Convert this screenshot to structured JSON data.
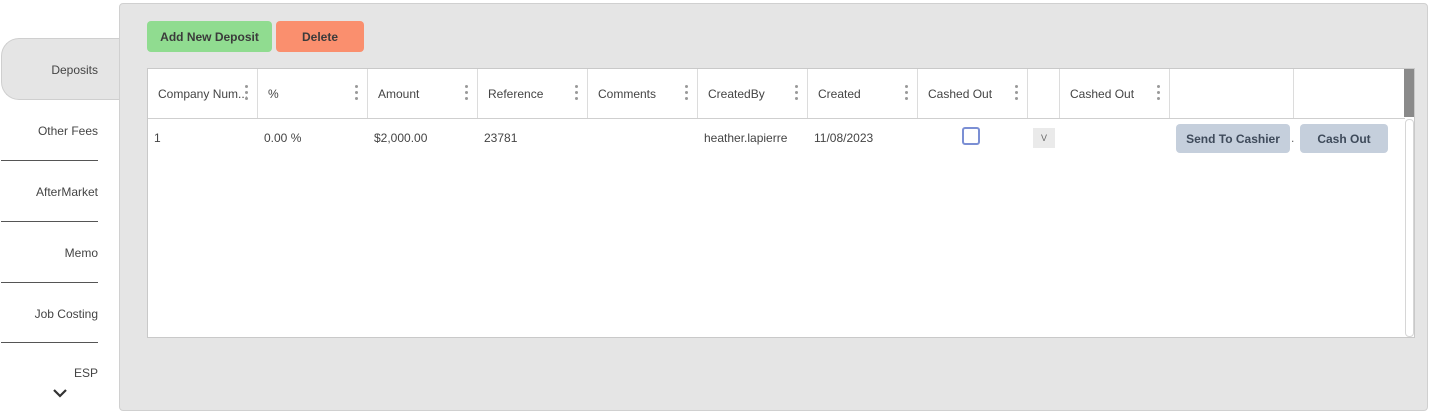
{
  "sidebar": {
    "tabs": [
      {
        "label": "Deposits",
        "active": true
      },
      {
        "label": "Other Fees"
      },
      {
        "label": "AfterMarket"
      },
      {
        "label": "Memo"
      },
      {
        "label": "Job Costing"
      },
      {
        "label": "ESP"
      }
    ],
    "more_icon": "chevron-down-icon"
  },
  "toolbar": {
    "add_label": "Add New Deposit",
    "delete_label": "Delete"
  },
  "grid": {
    "columns": [
      "Company Num...",
      "%",
      "Amount",
      "Reference",
      "Comments",
      "CreatedBy",
      "Created",
      "Cashed Out",
      "",
      "Cashed Out",
      "",
      ""
    ],
    "rows": [
      {
        "company_num": "1",
        "percent": "0.00 %",
        "amount": "$2,000.00",
        "reference": "23781",
        "comments": "",
        "created_by": "heather.lapierre",
        "created": "11/08/2023",
        "cashed_out_checked": false,
        "v_label": "V",
        "cashed_out_2": "",
        "send_label": "Send To Cashier",
        "separator": ".",
        "cash_out_label": "Cash Out"
      }
    ]
  },
  "colors": {
    "add_button": "#90dc90",
    "delete_button": "#fa8f6e",
    "action_button": "#c5cfdc",
    "panel_bg": "#e5e5e5",
    "checkbox_border": "#7b8fd4"
  }
}
